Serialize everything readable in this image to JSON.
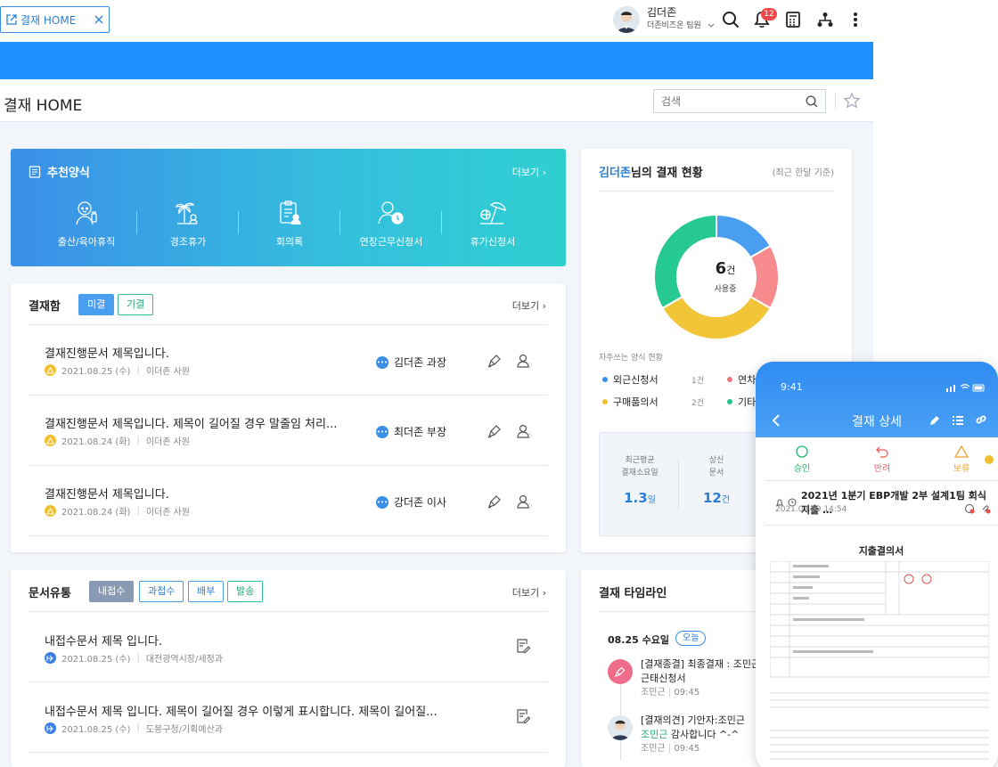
{
  "tab": {
    "label": "결재 HOME"
  },
  "user": {
    "name": "김더존",
    "dept": "더존비즈온 팀원"
  },
  "notifications": {
    "count": "12"
  },
  "page": {
    "title": "결재 HOME",
    "search_placeholder": "검색"
  },
  "recommend": {
    "title": "추천양식",
    "more": "더보기",
    "items": [
      {
        "label": "출산/육아휴직",
        "icon": "baby-icon"
      },
      {
        "label": "경조휴가",
        "icon": "palm-tree-icon"
      },
      {
        "label": "회의록",
        "icon": "clipboard-icon"
      },
      {
        "label": "연장근무신청서",
        "icon": "user-clock-icon"
      },
      {
        "label": "휴가신청서",
        "icon": "beach-icon"
      }
    ]
  },
  "approval": {
    "title": "결재함",
    "tabs": [
      "미결",
      "기결"
    ],
    "more": "더보기",
    "rows": [
      {
        "title": "결재진행문서 제목입니다.",
        "date": "2021.08.25 (수)",
        "author": "이더존 사원",
        "approver": "김더존 과장"
      },
      {
        "title": "결재진행문서 제목입니다. 제목이 길어질 경우 말줄임 처리...",
        "date": "2021.08.24 (화)",
        "author": "이더존 사원",
        "approver": "최더존 부장"
      },
      {
        "title": "결재진행문서 제목입니다.",
        "date": "2021.08.24 (화)",
        "author": "이더존 사원",
        "approver": "강더존 이사"
      }
    ]
  },
  "docflow": {
    "title": "문서유통",
    "tabs": [
      "내접수",
      "과접수",
      "배부",
      "발송"
    ],
    "more": "더보기",
    "rows": [
      {
        "title": "내접수문서 제목 입니다.",
        "date": "2021.08.25 (수)",
        "dept": "대전광역시장/세정과"
      },
      {
        "title": "내접수문서 제목 입니다. 제목이 길어질 경우 이렇게 표시합니다. 제목이 길어질...",
        "date": "2021.08.25 (수)",
        "dept": "도봉구청/기획예산과"
      }
    ]
  },
  "status": {
    "name": "김더존",
    "title_suffix": "님의 결재 현황",
    "period": "(최근 한달 기준)",
    "center_value": "6",
    "center_unit": "건",
    "center_label": "사용중",
    "freq_label": "자주쓰는 양식 현황",
    "legend": [
      {
        "label": "외근신청서",
        "count": "1건",
        "color": "#3a8ee6"
      },
      {
        "label": "연차",
        "count": "",
        "color": "#f0787a"
      },
      {
        "label": "구매품의서",
        "count": "2건",
        "color": "#f0c030"
      },
      {
        "label": "기타",
        "count": "",
        "color": "#22c38e"
      }
    ],
    "stats": [
      {
        "label1": "최근평균",
        "label2": "결재소요일",
        "value": "1.3",
        "unit": "일"
      },
      {
        "label1": "상신",
        "label2": "문서",
        "value": "12",
        "unit": "건"
      }
    ]
  },
  "chart_data": {
    "type": "pie",
    "categories": [
      "외근신청서",
      "연차",
      "구매품의서",
      "기타"
    ],
    "values": [
      1,
      1,
      2,
      2
    ],
    "colors": [
      "#4a9ef0",
      "#f78a8c",
      "#f2c438",
      "#26c98f"
    ]
  },
  "timeline": {
    "title": "결재 타임라인",
    "date": "08.25 수요일",
    "today": "오늘",
    "items": [
      {
        "line1": "[결재종결] 최종결재 : 조민근",
        "line2": "근태신청서",
        "meta": "조민근",
        "time": "09:45"
      },
      {
        "line1": "[결재의견] 기안자:조민근",
        "highlight": "조민근",
        "line2": " 감사합니다 ^-^",
        "meta": "조민근",
        "time": "09:45"
      }
    ]
  },
  "phone": {
    "time": "9:41",
    "title": "결재 상세",
    "actions": [
      {
        "label": "승인",
        "color": "#22b86e"
      },
      {
        "label": "반려",
        "color": "#ef5b5b"
      },
      {
        "label": "보류",
        "color": "#f0a030"
      }
    ],
    "subject": "2021년 1분기 EBP개발 2부 설계1팀 회식 지출 …",
    "date": "2021.03.09 14:54",
    "doc_title": "지출결의서"
  }
}
